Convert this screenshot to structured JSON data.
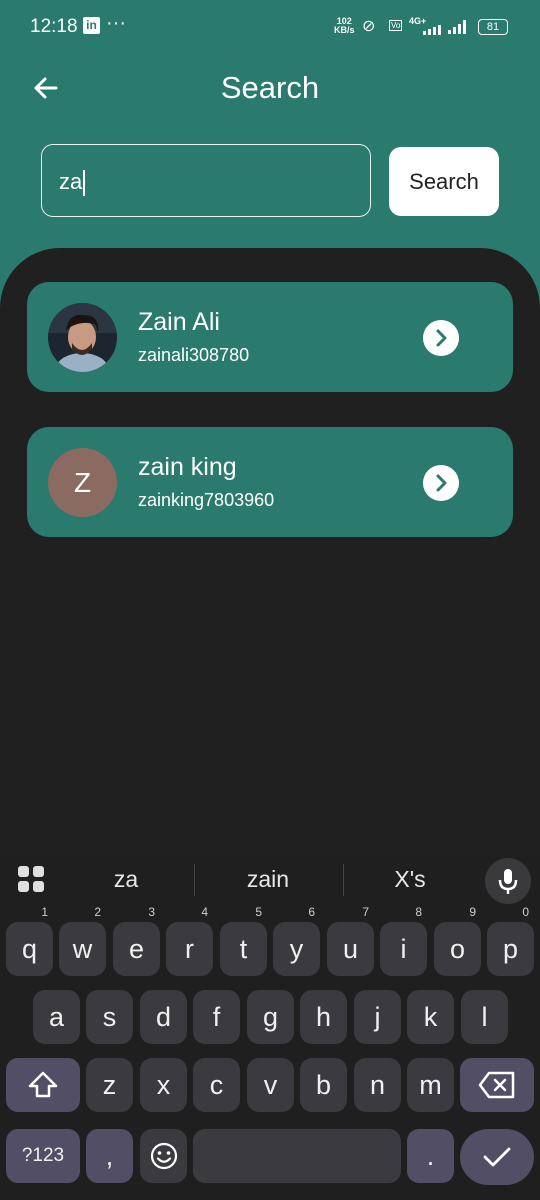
{
  "status_bar": {
    "time": "12:18",
    "app_icon": "linkedin-icon",
    "more": "···",
    "speed_value": "102",
    "speed_unit": "KB/s",
    "network": "4G+",
    "battery": "81"
  },
  "header": {
    "title": "Search",
    "back_icon": "arrow-left-icon"
  },
  "search": {
    "value": "za",
    "button_label": "Search"
  },
  "results": [
    {
      "name": "Zain Ali",
      "username": "zainali308780",
      "avatar": "photo"
    },
    {
      "name": "zain king",
      "username": "zainking7803960",
      "avatar_letter": "Z"
    }
  ],
  "keyboard": {
    "suggestions": [
      "za",
      "zain",
      "X's"
    ],
    "row1": [
      "q",
      "w",
      "e",
      "r",
      "t",
      "y",
      "u",
      "i",
      "o",
      "p"
    ],
    "row1_hints": [
      "1",
      "2",
      "3",
      "4",
      "5",
      "6",
      "7",
      "8",
      "9",
      "0"
    ],
    "row2": [
      "a",
      "s",
      "d",
      "f",
      "g",
      "h",
      "j",
      "k",
      "l"
    ],
    "row3": [
      "z",
      "x",
      "c",
      "v",
      "b",
      "n",
      "m"
    ],
    "symbols_label": "?123",
    "comma": ",",
    "period": "."
  },
  "colors": {
    "brand": "#2a7a6d",
    "panel": "#202021",
    "keyboard": "#1f1f1f"
  }
}
